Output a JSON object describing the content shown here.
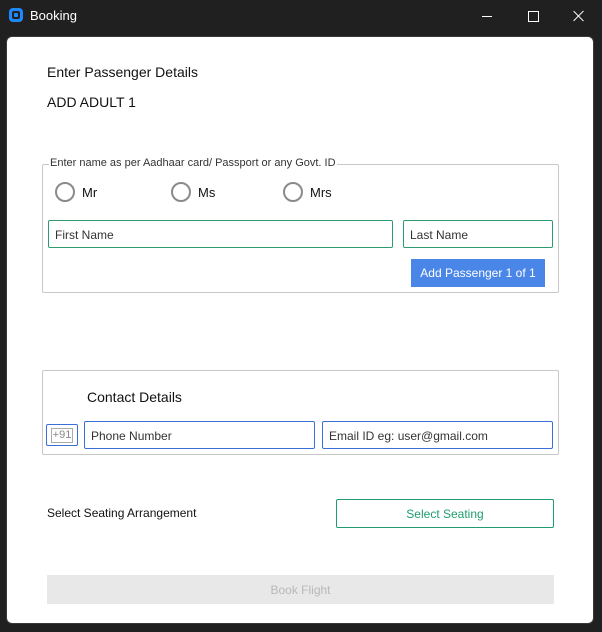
{
  "window": {
    "title": "Booking",
    "icon": "app-icon",
    "controls": [
      "minimize-icon",
      "maximize-icon",
      "close-icon"
    ]
  },
  "form": {
    "heading": "Enter Passenger Details",
    "subheading": "ADD ADULT 1",
    "name_group": {
      "legend": "Enter name as per Aadhaar card/ Passport or any Govt. ID",
      "titles": [
        {
          "label": "Mr"
        },
        {
          "label": "Ms"
        },
        {
          "label": "Mrs"
        }
      ],
      "first_name_placeholder": "First Name",
      "last_name_placeholder": "Last Name",
      "add_button": "Add Passenger 1 of 1"
    },
    "contact_group": {
      "title": "Contact Details",
      "country_code": "+91",
      "phone_placeholder": "Phone Number",
      "email_placeholder": "Email ID eg: user@gmail.com"
    },
    "seating": {
      "label": "Select Seating Arrangement",
      "button": "Select Seating"
    },
    "book_button": "Book Flight"
  },
  "colors": {
    "accent": "#4a86e8",
    "green": "#1f9d6e",
    "input_border_green": "#2e9b6f",
    "input_border_blue": "#3a6fd8",
    "disabled_bg": "#e8e8e8",
    "titlebar": "#202020"
  }
}
